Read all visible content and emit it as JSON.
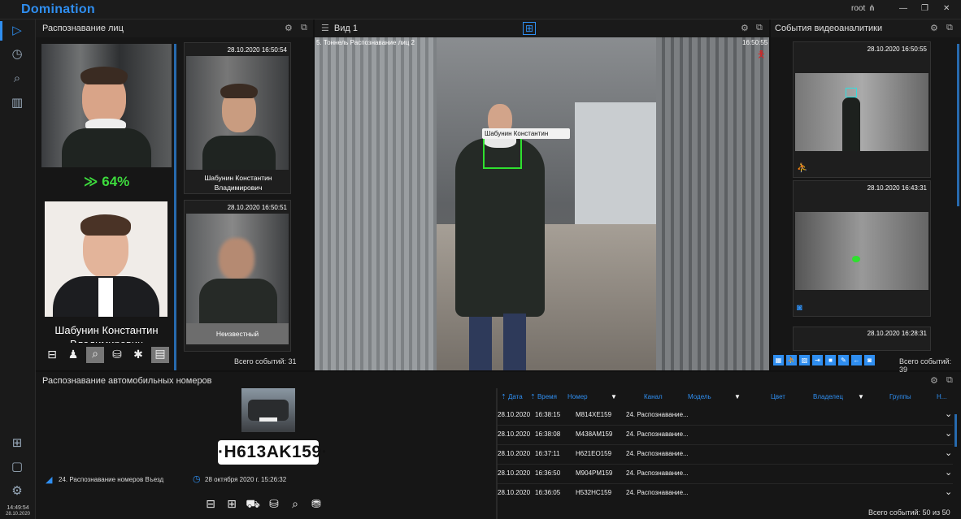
{
  "app": {
    "title": "Domination",
    "user": "root"
  },
  "sidebar": {
    "clock": "14:49:54",
    "date": "28.10.2020"
  },
  "face_panel": {
    "title": "Распознавание лиц",
    "match_percent": "64%",
    "match_name": "Шабунин Константин Владимирович",
    "events": [
      {
        "timestamp": "28.10.2020 16:50:54",
        "name": "Шабунин Константин Владимирович"
      },
      {
        "timestamp": "28.10.2020 16:50:51",
        "name": "Неизвестный"
      }
    ],
    "total": "Всего событий: 31"
  },
  "view": {
    "title": "Вид 1",
    "camera": "5. Тоннель Распознавание лиц 2",
    "time": "16:50:55",
    "face_label": "Шабунин Константин"
  },
  "analytics": {
    "title": "События видеоаналитики",
    "events": [
      {
        "timestamp": "28.10.2020 16:50:55"
      },
      {
        "timestamp": "28.10.2020 16:43:31"
      },
      {
        "timestamp": "28.10.2020 16:28:31"
      }
    ],
    "total": "Всего событий: 39"
  },
  "plates": {
    "title": "Распознавание автомобильных номеров",
    "plate": "·H613AK159·",
    "channel": "24. Распознавание номеров Въезд",
    "datetime": "28 октября 2020 г. 15:26:32",
    "columns": [
      "Дата",
      "Время",
      "Номер",
      "Канал",
      "Модель",
      "Цвет",
      "Владелец",
      "Группы",
      "Н..."
    ],
    "rows": [
      {
        "date": "28.10.2020",
        "time": "16:38:15",
        "plate": "M814XE159",
        "channel": "24. Распознавание..."
      },
      {
        "date": "28.10.2020",
        "time": "16:38:08",
        "plate": "M438AM159",
        "channel": "24. Распознавание..."
      },
      {
        "date": "28.10.2020",
        "time": "16:37:11",
        "plate": "H621EO159",
        "channel": "24. Распознавание..."
      },
      {
        "date": "28.10.2020",
        "time": "16:36:50",
        "plate": "M904PM159",
        "channel": "24. Распознавание..."
      },
      {
        "date": "28.10.2020",
        "time": "16:36:05",
        "plate": "H532HC159",
        "channel": "24. Распознавание..."
      }
    ],
    "total": "Всего событий: 50 из 50"
  }
}
